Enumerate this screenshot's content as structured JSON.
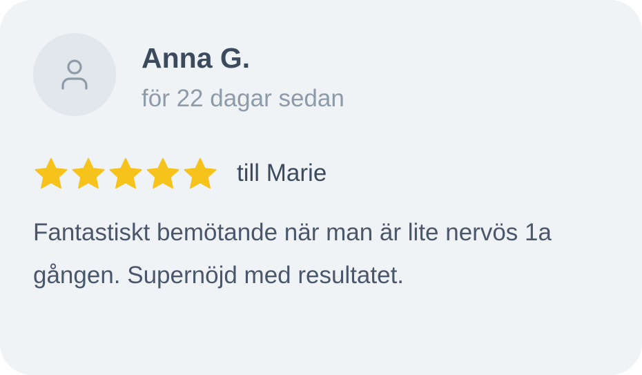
{
  "review": {
    "author": "Anna G.",
    "time_ago": "för 22 dagar sedan",
    "rating": 5,
    "max_rating": 5,
    "recipient": "till Marie",
    "text": "Fantastiskt bemötande när man är lite nervös 1a gången. Supernöjd med resultatet."
  },
  "avatar": {
    "icon": "user-icon"
  },
  "colors": {
    "card_background": "#eff3f6",
    "avatar_background": "#e2e7ec",
    "star": "#f6c21c",
    "name_text": "#3b4a5c",
    "muted_text": "#8d9aa8",
    "body_text": "#4a576a"
  }
}
